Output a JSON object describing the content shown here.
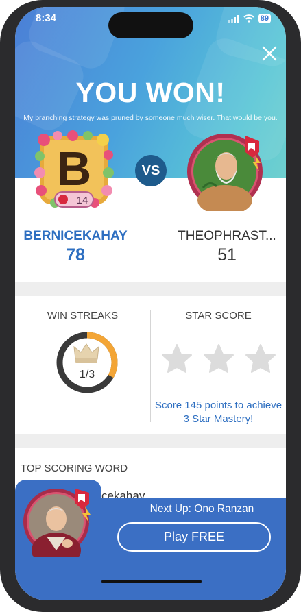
{
  "status": {
    "time": "8:34",
    "battery": "89"
  },
  "header": {
    "title": "YOU WON!",
    "subtitle": "My branching strategy was pruned by someone much wiser. That would be you."
  },
  "match": {
    "vs_label": "VS",
    "player": {
      "avatar_letter": "B",
      "level": "14",
      "name": "BERNICEKAHAY",
      "score": "78"
    },
    "opponent": {
      "name": "THEOPHRAST...",
      "score": "51"
    }
  },
  "stats": {
    "win_streaks": {
      "title": "WIN STREAKS",
      "count_text": "1/3",
      "progress": 0.333
    },
    "star_score": {
      "title": "STAR SCORE",
      "stars_filled": 0,
      "stars_total": 3,
      "mastery_text": "Score 145 points to achieve 3 Star Mastery!"
    }
  },
  "top_scoring_word": {
    "title": "TOP SCORING WORD",
    "word_partial": "cekahay"
  },
  "next_up": {
    "label": "Next Up: Ono Ranzan",
    "play_button": "Play FREE"
  },
  "colors": {
    "accent_blue": "#2e6fc1",
    "bar_blue": "#3b6fc4",
    "streak_orange": "#f3a536",
    "vs_navy": "#1e5b8c",
    "badge_red": "#d8283e"
  }
}
